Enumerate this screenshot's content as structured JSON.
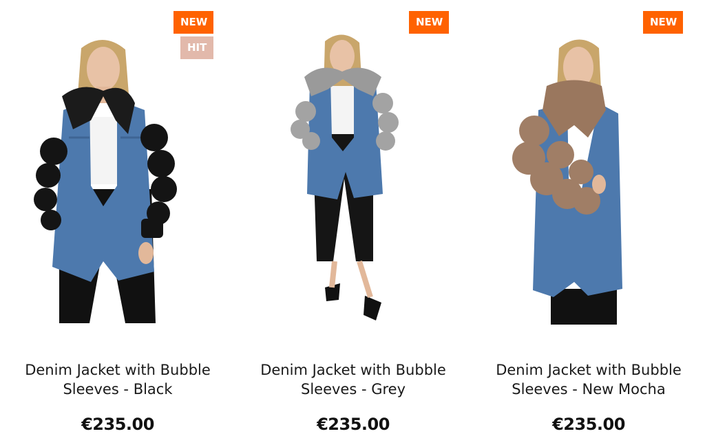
{
  "products": [
    {
      "title_line1": "Denim Jacket with Bubble",
      "title_line2": "Sleeves - Black",
      "price": "€235.00",
      "badges": [
        "NEW",
        "HIT"
      ],
      "sleeve_color": "#141414",
      "collar_color": "#1b1b1b"
    },
    {
      "title_line1": "Denim Jacket with Bubble",
      "title_line2": "Sleeves - Grey",
      "price": "€235.00",
      "badges": [
        "NEW"
      ],
      "sleeve_color": "#a3a3a3",
      "collar_color": "#9a9a9a"
    },
    {
      "title_line1": "Denim Jacket with Bubble",
      "title_line2": "Sleeves - New Mocha",
      "price": "€235.00",
      "badges": [
        "NEW"
      ],
      "sleeve_color": "#a07e66",
      "collar_color": "#9a775e"
    }
  ],
  "colors": {
    "badge_new": "#ff6200",
    "badge_hit": "#e2b9ab",
    "denim": "#4d79ad"
  }
}
